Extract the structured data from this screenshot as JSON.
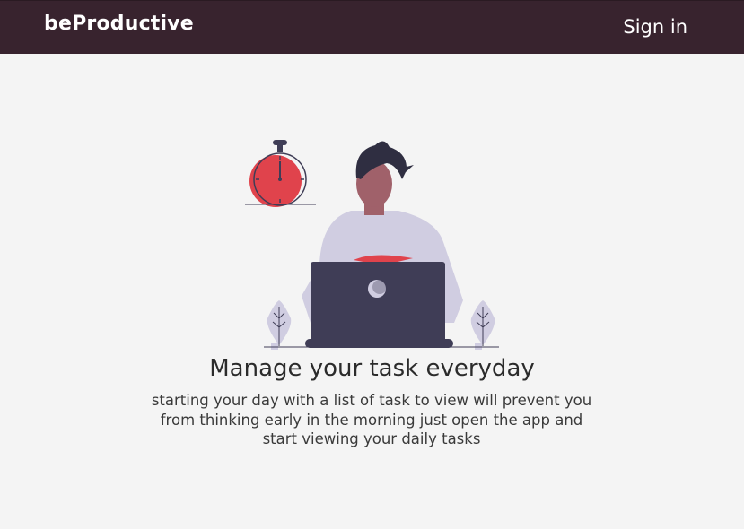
{
  "navbar": {
    "brand": "beProductive",
    "signin_label": "Sign in",
    "background": "#38232e"
  },
  "hero": {
    "illustration": "person-working-at-laptop-with-stopwatch",
    "headline": "Manage your task everyday",
    "description": "starting your day with a list of task to view will prevent you from thinking early in the morning just open the app and start viewing your daily tasks"
  },
  "colors": {
    "accent": "#e0434c",
    "laptop": "#3f3d56",
    "shirt": "#d0cde1",
    "skin": "#a0616a",
    "page_background": "#f4f4f4"
  }
}
